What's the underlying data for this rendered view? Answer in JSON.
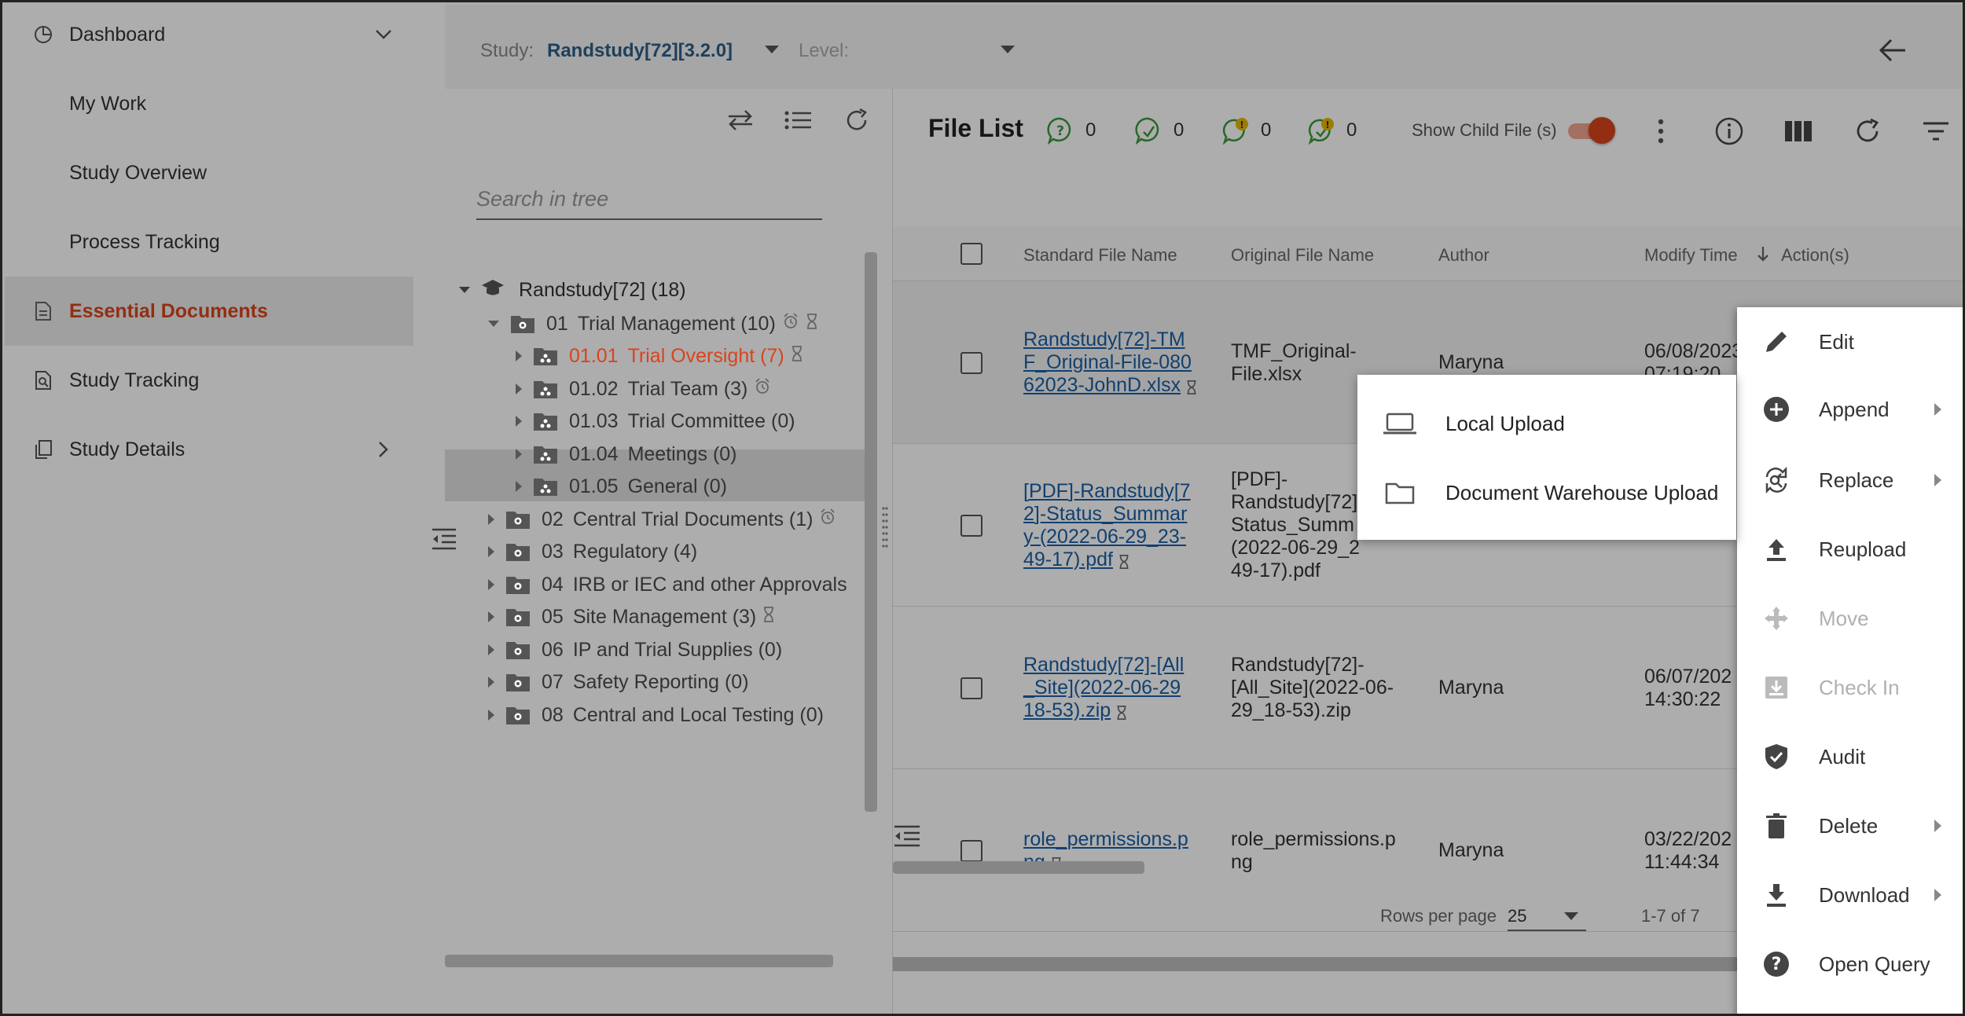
{
  "sidebar": {
    "items": [
      {
        "label": "Dashboard",
        "icon": "pie-chart-icon",
        "has_chevron": "down"
      },
      {
        "label": "My Work"
      },
      {
        "label": "Study Overview"
      },
      {
        "label": "Process Tracking"
      },
      {
        "label": "Essential Documents",
        "icon": "document-icon",
        "active": true
      },
      {
        "label": "Study Tracking",
        "icon": "doc-search-icon"
      },
      {
        "label": "Study Details",
        "icon": "copy-icon",
        "has_chevron": "right"
      }
    ]
  },
  "topbar": {
    "study_label": "Study:",
    "study_value": "Randstudy[72][3.2.0]",
    "level_label": "Level:"
  },
  "tree": {
    "search_placeholder": "Search in tree",
    "root": "Randstudy[72] (18)",
    "nodes": [
      {
        "code": "01",
        "name": "Trial Management (10)"
      },
      {
        "code": "01.01",
        "name": "Trial Oversight (7)"
      },
      {
        "code": "01.02",
        "name": "Trial Team (3)"
      },
      {
        "code": "01.03",
        "name": "Trial Committee (0)"
      },
      {
        "code": "01.04",
        "name": "Meetings (0)"
      },
      {
        "code": "01.05",
        "name": "General (0)"
      },
      {
        "code": "02",
        "name": "Central Trial Documents (1)"
      },
      {
        "code": "03",
        "name": "Regulatory (4)"
      },
      {
        "code": "04",
        "name": "IRB or IEC and other Approvals"
      },
      {
        "code": "05",
        "name": "Site Management (3)"
      },
      {
        "code": "06",
        "name": "IP and Trial Supplies (0)"
      },
      {
        "code": "07",
        "name": "Safety Reporting (0)"
      },
      {
        "code": "08",
        "name": "Central and Local Testing (0)"
      }
    ]
  },
  "file_list": {
    "title": "File List",
    "counters": [
      "0",
      "0",
      "0",
      "0"
    ],
    "show_child_label": "Show Child File (s)",
    "columns": [
      "Standard File Name",
      "Original File Name",
      "Author",
      "Modify Time",
      "Action(s)"
    ],
    "rows": [
      {
        "std_lines": [
          "Randstudy[72]-TM",
          "F_Original-File-080",
          "62023-JohnD.xlsx"
        ],
        "orig_lines": [
          "TMF_Original-",
          "File.xlsx"
        ],
        "author": "Maryna",
        "time_lines": [
          "06/08/2023",
          "07:19:20"
        ]
      },
      {
        "std_lines": [
          "[PDF]-Randstudy[7",
          "2]-Status_Summar",
          "y-(2022-06-29_23-",
          "49-17).pdf"
        ],
        "orig_lines": [
          "[PDF]-",
          "Randstudy[72]",
          "Status_Summ",
          "(2022-06-29_2",
          "49-17).pdf"
        ],
        "author": "",
        "time_lines": [
          "",
          ""
        ]
      },
      {
        "std_lines": [
          "Randstudy[72]-[All",
          "_Site](2022-06-29",
          "18-53).zip"
        ],
        "orig_lines": [
          "Randstudy[72]-",
          "[All_Site](2022-06-",
          "29_18-53).zip"
        ],
        "author": "Maryna",
        "time_lines": [
          "06/07/202",
          "14:30:22"
        ]
      },
      {
        "std_lines": [
          "role_permissions.p",
          "ng"
        ],
        "orig_lines": [
          "role_permissions.p",
          "ng"
        ],
        "author": "Maryna",
        "time_lines": [
          "03/22/202",
          "11:44:34"
        ]
      }
    ],
    "rows_per_page_label": "Rows per page",
    "rows_per_page_value": "25",
    "range": "1-7 of 7"
  },
  "context_menu": {
    "items": [
      {
        "label": "Edit",
        "icon": "pencil-icon"
      },
      {
        "label": "Append",
        "icon": "add-circle-icon",
        "submenu": true
      },
      {
        "label": "Replace",
        "icon": "replace-icon",
        "submenu": true
      },
      {
        "label": "Reupload",
        "icon": "upload-icon"
      },
      {
        "label": "Move",
        "icon": "move-icon",
        "disabled": true
      },
      {
        "label": "Check In",
        "icon": "check-in-icon",
        "disabled": true
      },
      {
        "label": "Audit",
        "icon": "shield-check-icon"
      },
      {
        "label": "Delete",
        "icon": "trash-icon",
        "submenu": true
      },
      {
        "label": "Download",
        "icon": "download-icon",
        "submenu": true
      },
      {
        "label": "Open Query",
        "icon": "help-circle-icon"
      }
    ]
  },
  "append_submenu": {
    "items": [
      {
        "label": "Local Upload",
        "icon": "laptop-icon"
      },
      {
        "label": "Document Warehouse Upload",
        "icon": "folder-icon"
      }
    ]
  },
  "colors": {
    "accent": "#d9441c",
    "link": "#1a5fa6",
    "study_value": "#2d5f87",
    "counter_icon": "#3a9a3a"
  }
}
